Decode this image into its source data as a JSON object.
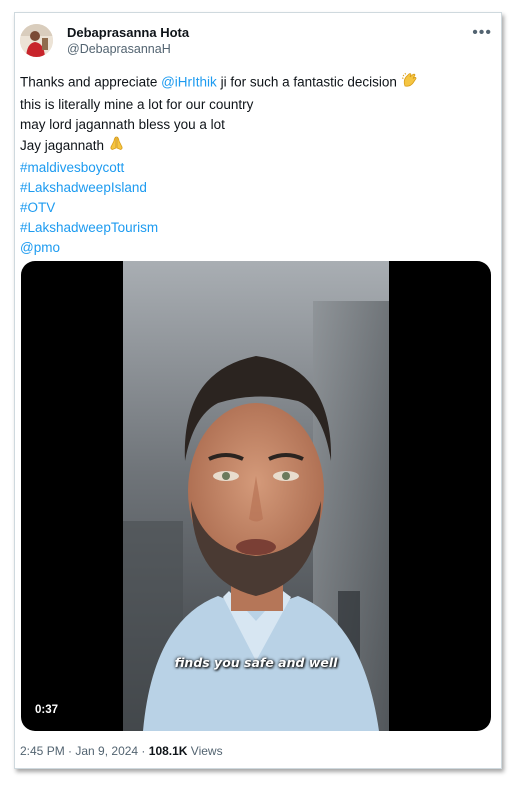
{
  "author": {
    "display_name": "Debaprasanna Hota",
    "handle": "@DebaprasannaH"
  },
  "more_icon": "more-horizontal-icon",
  "tweet": {
    "line1_prefix": "Thanks and appreciate ",
    "line1_mention": "@iHrIthik",
    "line1_suffix": "  ji for such a fantastic decision",
    "line1_emoji": "clapping-hands-icon",
    "line2": "this is literally mine a lot for our country",
    "line3": "may lord jagannath bless you a lot",
    "line4_text": "Jay jagannath",
    "line4_emoji": "folded-hands-icon",
    "tags": [
      "#maldivesboycott",
      "#LakshadweepIsland",
      "#OTV",
      "#LakshadweepTourism",
      "@pmo"
    ]
  },
  "video": {
    "caption": "finds you safe and well",
    "duration": "0:37"
  },
  "meta": {
    "time": "2:45 PM",
    "sep1": " · ",
    "date": "Jan 9, 2024",
    "sep2": " · ",
    "views_count": "108.1K",
    "views_label": " Views"
  },
  "colors": {
    "link": "#1d9bf0",
    "text": "#0f1419",
    "secondary": "#536471",
    "border": "#cfd9de"
  }
}
